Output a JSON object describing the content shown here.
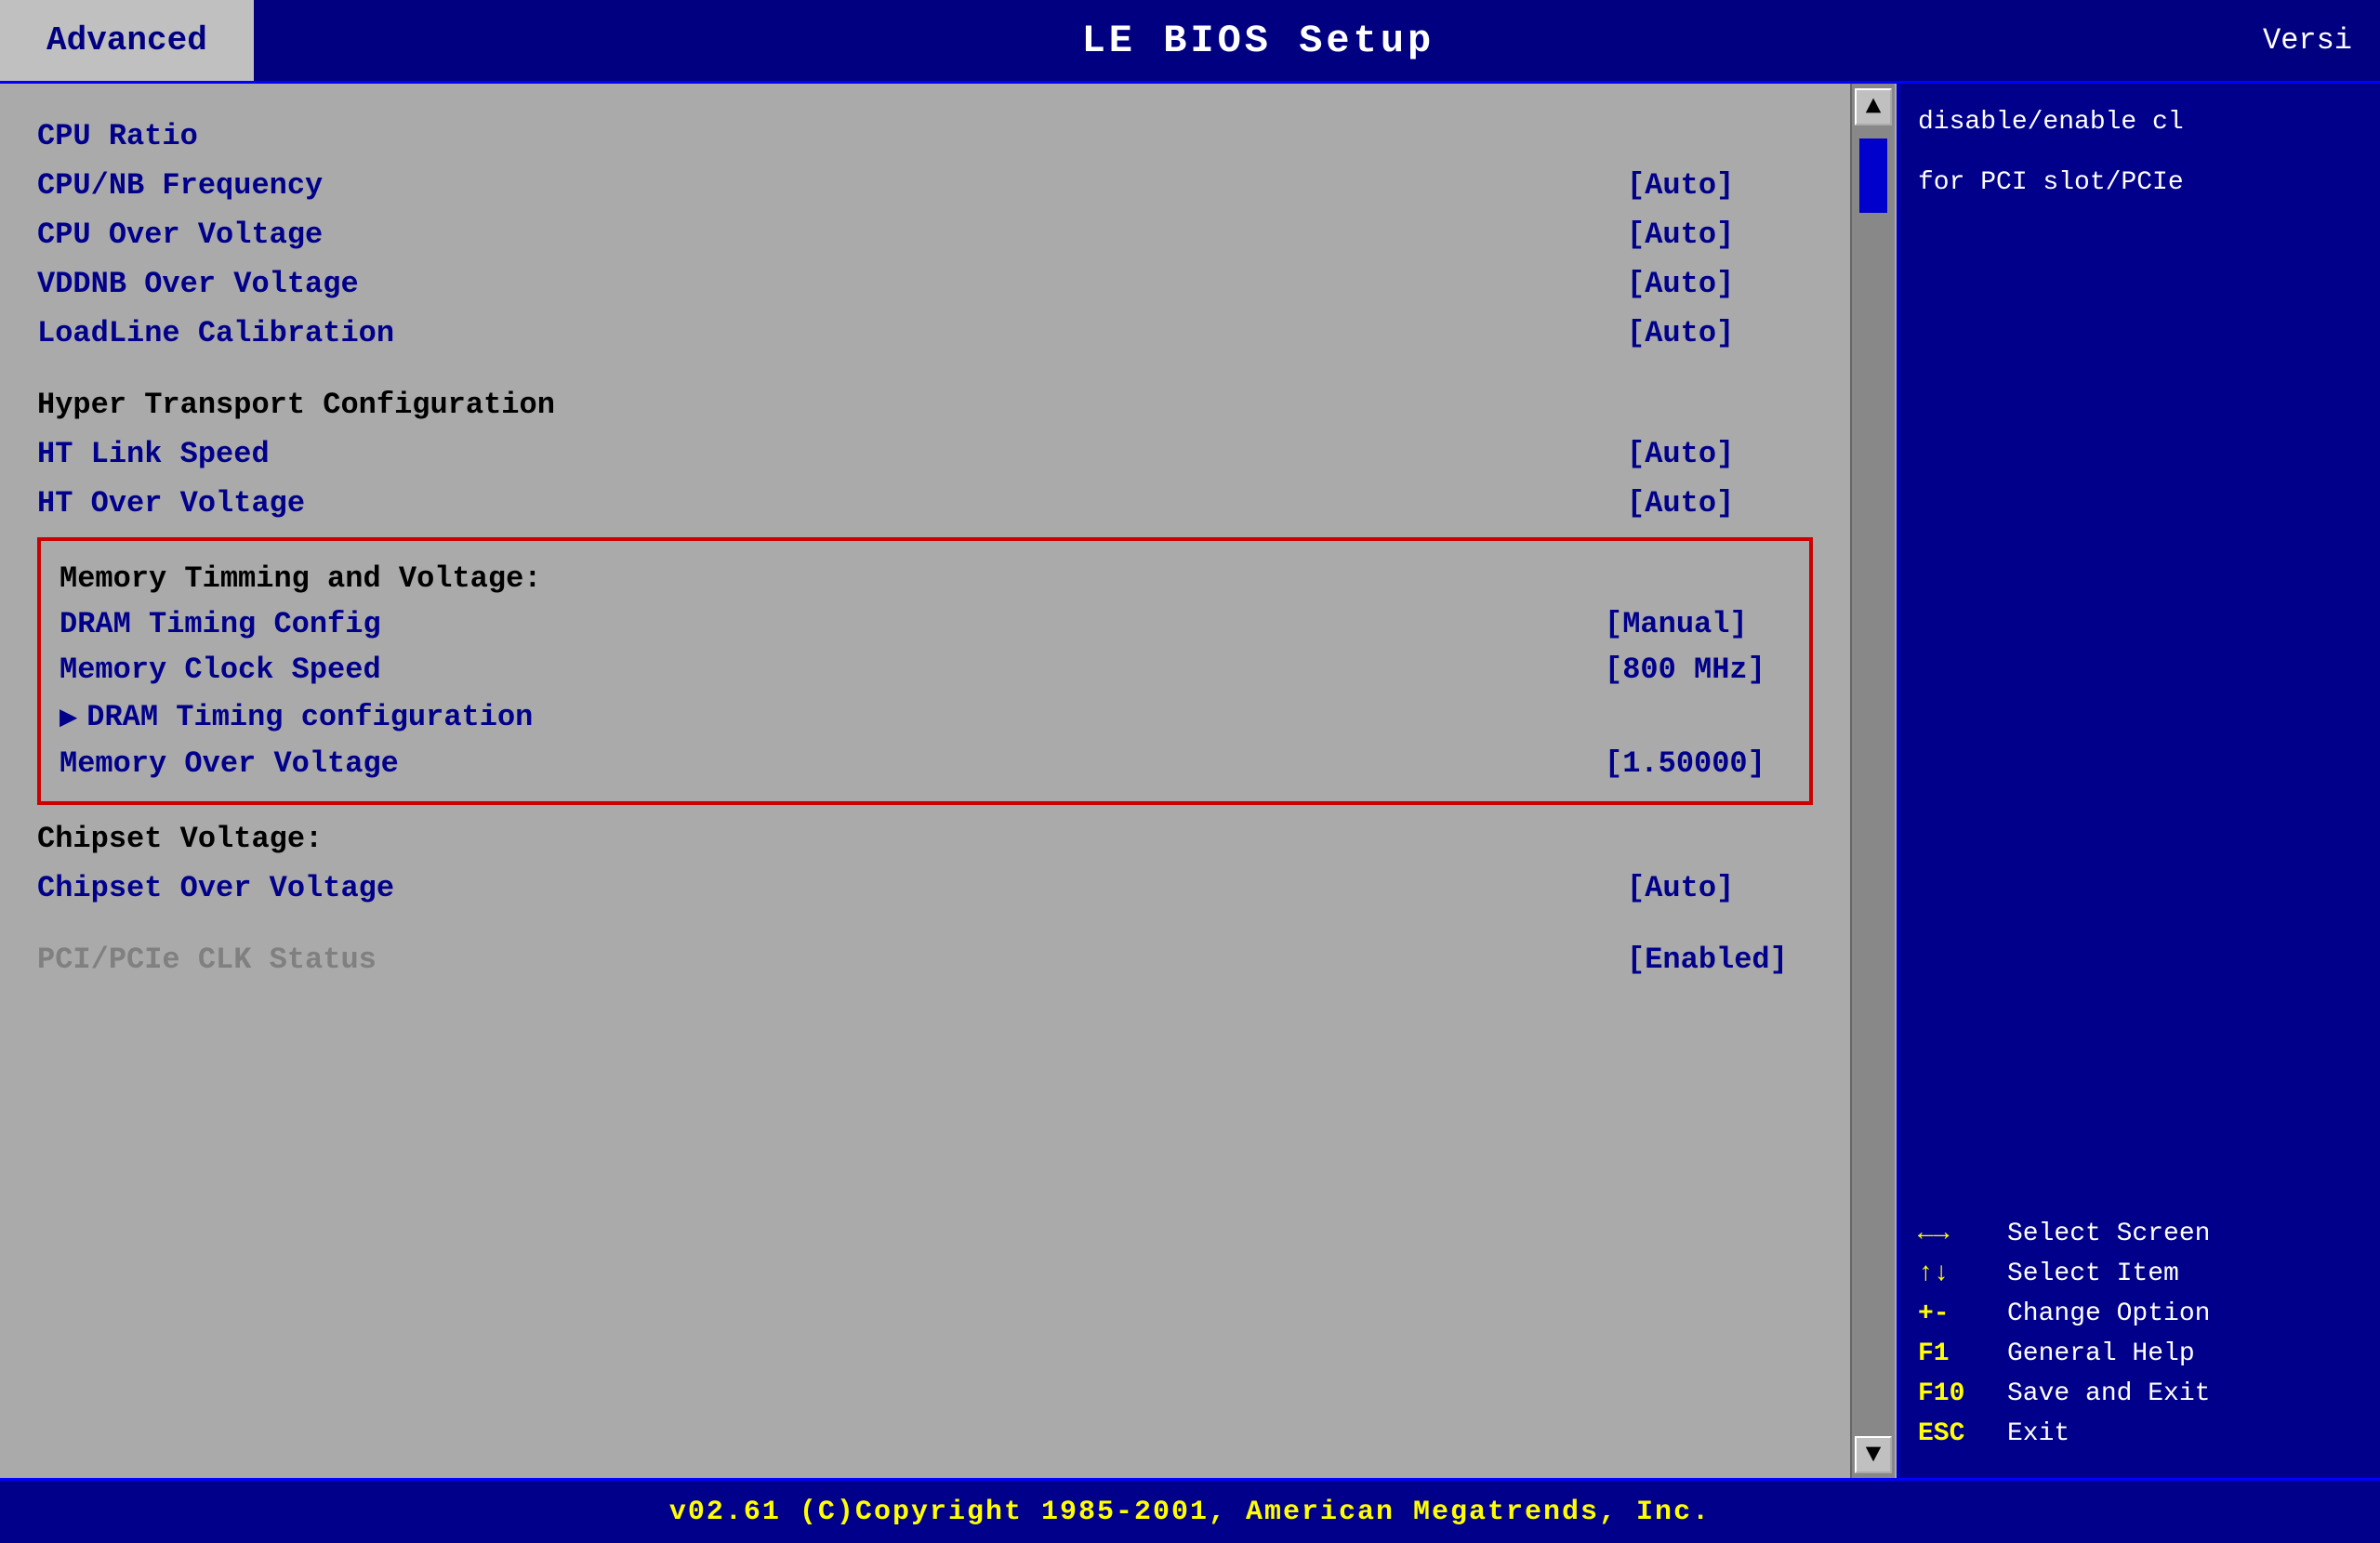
{
  "header": {
    "tab_label": "Advanced",
    "title": "LE BIOS Setup",
    "version_label": "Versi"
  },
  "settings": {
    "cpu_ratio": {
      "label": "CPU Ratio",
      "value": ""
    },
    "cpu_nb_frequency": {
      "label": "CPU/NB Frequency",
      "value": "[Auto]"
    },
    "cpu_over_voltage": {
      "label": "CPU Over Voltage",
      "value": "[Auto]"
    },
    "vddnb_over_voltage": {
      "label": "VDDNB Over Voltage",
      "value": "[Auto]"
    },
    "loadline_calibration": {
      "label": "LoadLine Calibration",
      "value": "[Auto]"
    },
    "ht_section_header": {
      "label": "Hyper Transport Configuration",
      "value": ""
    },
    "ht_link_speed": {
      "label": "HT Link Speed",
      "value": "[Auto]"
    },
    "ht_over_voltage": {
      "label": "HT Over Voltage",
      "value": "[Auto]"
    },
    "memory_section_header": {
      "label": "Memory Timming and Voltage:",
      "value": ""
    },
    "dram_timing_config": {
      "label": "DRAM Timing Config",
      "value": "[Manual]"
    },
    "memory_clock_speed": {
      "label": "Memory Clock Speed",
      "value": "[800 MHz]"
    },
    "dram_timing_configuration": {
      "label": "DRAM Timing configuration",
      "value": ""
    },
    "memory_over_voltage": {
      "label": "Memory Over Voltage",
      "value": "[1.50000]"
    },
    "chipset_voltage_header": {
      "label": "Chipset Voltage:",
      "value": ""
    },
    "chipset_over_voltage": {
      "label": "Chipset Over Voltage",
      "value": "[Auto]"
    },
    "pci_pcie_clk_status": {
      "label": "PCI/PCIe CLK Status",
      "value": "[Enabled]"
    }
  },
  "help": {
    "text_line1": "disable/enable cl",
    "text_line2": "for PCI slot/PCIe"
  },
  "key_bindings": [
    {
      "key": "←→",
      "desc": "Select Screen"
    },
    {
      "key": "↑↓",
      "desc": "Select Item"
    },
    {
      "key": "+-",
      "desc": "Change Option"
    },
    {
      "key": "F1",
      "desc": "General Help"
    },
    {
      "key": "F10",
      "desc": "Save and Exit"
    },
    {
      "key": "ESC",
      "desc": "Exit"
    }
  ],
  "footer": {
    "text": "v02.61  (C)Copyright 1985-2001, American Megatrends, Inc."
  }
}
